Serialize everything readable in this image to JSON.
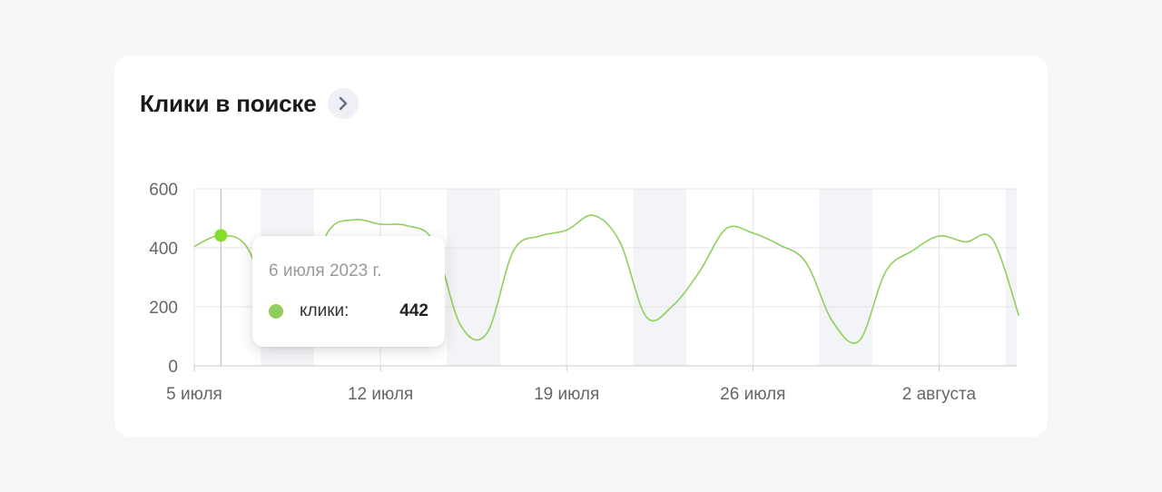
{
  "header": {
    "title": "Клики в поиске",
    "arrow_icon": "chevron-right-icon"
  },
  "colors": {
    "line": "#8fd05c",
    "marker": "#84dd2c",
    "weekend_band": "#f3f4f7",
    "grid": "#e4e4e4",
    "axis_text": "#666666"
  },
  "tooltip": {
    "date": "6 июля 2023 г.",
    "label": "клики:",
    "value": "442"
  },
  "chart_data": {
    "type": "line",
    "title": "Клики в поиске",
    "ylim": [
      0,
      600
    ],
    "yticks": [
      0,
      200,
      400,
      600
    ],
    "xlim": [
      "2023-07-05",
      "2023-08-05"
    ],
    "xticks": [
      {
        "date": "2023-07-05",
        "label": "5 июля"
      },
      {
        "date": "2023-07-12",
        "label": "12 июля"
      },
      {
        "date": "2023-07-19",
        "label": "19 июля"
      },
      {
        "date": "2023-07-26",
        "label": "26 июля"
      },
      {
        "date": "2023-08-02",
        "label": "2 августа"
      }
    ],
    "weekends": [
      [
        "2023-07-08",
        "2023-07-09"
      ],
      [
        "2023-07-15",
        "2023-07-16"
      ],
      [
        "2023-07-22",
        "2023-07-23"
      ],
      [
        "2023-07-29",
        "2023-07-30"
      ],
      [
        "2023-08-05",
        "2023-08-05"
      ]
    ],
    "grid": true,
    "highlight": {
      "date": "2023-07-06",
      "value": 442
    },
    "series": [
      {
        "values": [
          {
            "date": "2023-07-05",
            "value": 405
          },
          {
            "date": "2023-07-06",
            "value": 442
          },
          {
            "date": "2023-07-07",
            "value": 400
          },
          {
            "date": "2023-07-08",
            "value": 170
          },
          {
            "date": "2023-07-09",
            "value": 190
          },
          {
            "date": "2023-07-10",
            "value": 450
          },
          {
            "date": "2023-07-11",
            "value": 495
          },
          {
            "date": "2023-07-12",
            "value": 480
          },
          {
            "date": "2023-07-13",
            "value": 475
          },
          {
            "date": "2023-07-14",
            "value": 420
          },
          {
            "date": "2023-07-15",
            "value": 140
          },
          {
            "date": "2023-07-16",
            "value": 110
          },
          {
            "date": "2023-07-17",
            "value": 390
          },
          {
            "date": "2023-07-18",
            "value": 440
          },
          {
            "date": "2023-07-19",
            "value": 460
          },
          {
            "date": "2023-07-20",
            "value": 510
          },
          {
            "date": "2023-07-21",
            "value": 420
          },
          {
            "date": "2023-07-22",
            "value": 165
          },
          {
            "date": "2023-07-23",
            "value": 205
          },
          {
            "date": "2023-07-24",
            "value": 320
          },
          {
            "date": "2023-07-25",
            "value": 465
          },
          {
            "date": "2023-07-26",
            "value": 450
          },
          {
            "date": "2023-07-27",
            "value": 410
          },
          {
            "date": "2023-07-28",
            "value": 350
          },
          {
            "date": "2023-07-29",
            "value": 150
          },
          {
            "date": "2023-07-30",
            "value": 85
          },
          {
            "date": "2023-07-31",
            "value": 320
          },
          {
            "date": "2023-08-01",
            "value": 390
          },
          {
            "date": "2023-08-02",
            "value": 440
          },
          {
            "date": "2023-08-03",
            "value": 420
          },
          {
            "date": "2023-08-04",
            "value": 430
          },
          {
            "date": "2023-08-05",
            "value": 170
          }
        ]
      }
    ]
  }
}
